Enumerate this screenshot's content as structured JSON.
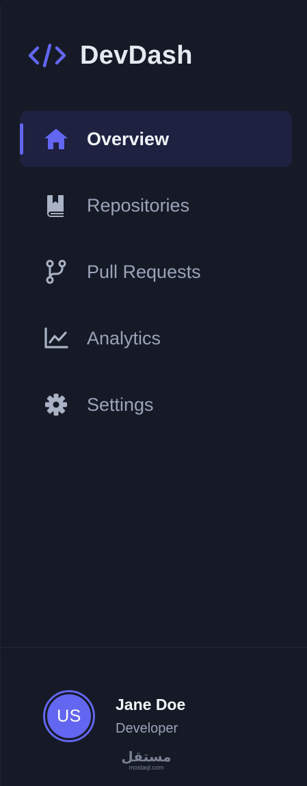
{
  "brand": {
    "name": "DevDash",
    "icon": "code-brackets-icon",
    "accent": "#6366f1"
  },
  "nav": {
    "items": [
      {
        "label": "Overview",
        "icon": "home-icon",
        "active": true
      },
      {
        "label": "Repositories",
        "icon": "book-icon",
        "active": false
      },
      {
        "label": "Pull Requests",
        "icon": "git-branch-icon",
        "active": false
      },
      {
        "label": "Analytics",
        "icon": "chart-line-icon",
        "active": false
      },
      {
        "label": "Settings",
        "icon": "gear-icon",
        "active": false
      }
    ]
  },
  "user": {
    "initials": "US",
    "name": "Jane Doe",
    "role": "Developer"
  },
  "watermark": {
    "text": "مستقل",
    "subtext": "mostaql.com"
  },
  "colors": {
    "background": "#151a26",
    "active_bg": "#1e2140",
    "accent": "#6366f1",
    "muted_text": "#9aa3b8",
    "icon_muted": "#aab3c5"
  }
}
